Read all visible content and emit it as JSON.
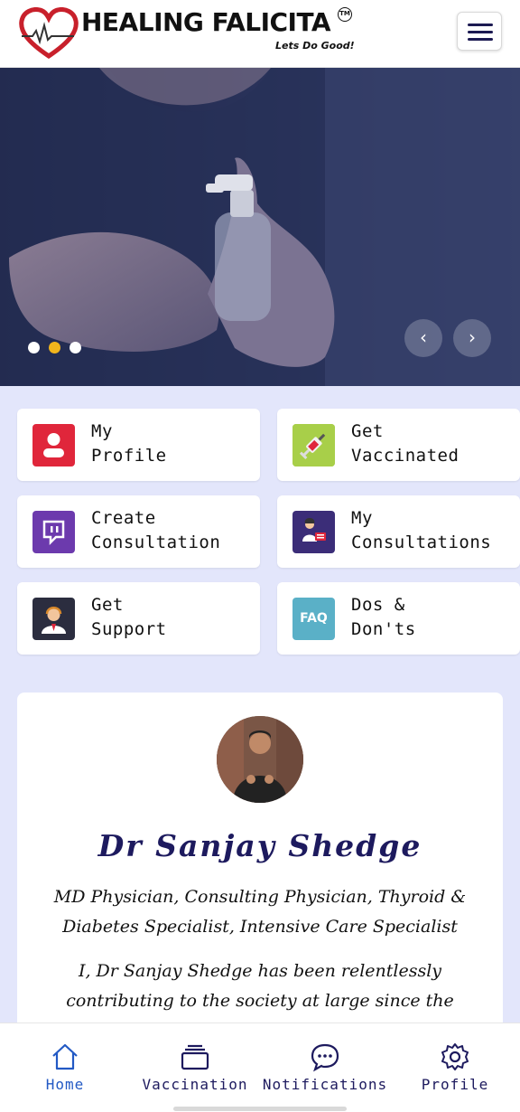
{
  "header": {
    "brand": "HEALING FALICITA",
    "trademark": "TM",
    "tagline": "Lets Do Good!",
    "logo_icon": "heart-pulse-icon",
    "menu_icon": "hamburger-menu-icon"
  },
  "hero": {
    "slide_count": 3,
    "active_slide": 2,
    "prev_icon": "chevron-left-icon",
    "next_icon": "chevron-right-icon",
    "prev_glyph": "‹",
    "next_glyph": "›"
  },
  "tiles": [
    {
      "label": "My\nProfile",
      "icon": "user-profile-icon",
      "color": "#e0263b"
    },
    {
      "label": "Get\nVaccinated",
      "icon": "syringe-icon",
      "color": "#9ec43c"
    },
    {
      "label": "Create\nConsultation",
      "icon": "chat-consultation-icon",
      "color": "#6c3aad"
    },
    {
      "label": "My\nConsultations",
      "icon": "doctor-icon",
      "color": "#3b2d78"
    },
    {
      "label": "Get\nSupport",
      "icon": "support-agent-icon",
      "color": "#2b2d3f"
    },
    {
      "label": "Dos &\nDon'ts",
      "icon": "faq-icon",
      "icon_text": "FAQ",
      "color": "#5ab0c7"
    }
  ],
  "doctor": {
    "name": "Dr Sanjay Shedge",
    "specialization": "MD Physician, Consulting Physician, Thyroid & Diabetes Specialist, Intensive Care Specialist",
    "bio": "I, Dr Sanjay Shedge has been relentlessly contributing to the society at large since the"
  },
  "bottom_nav": [
    {
      "label": "Home",
      "icon": "home-icon",
      "active": true
    },
    {
      "label": "Vaccination",
      "icon": "stack-icon",
      "active": false
    },
    {
      "label": "Notifications",
      "icon": "chat-bubble-icon",
      "active": false
    },
    {
      "label": "Profile",
      "icon": "gear-icon",
      "active": false
    }
  ],
  "colors": {
    "accent": "#1d1a5e",
    "active_nav": "#2259c4",
    "background": "#e3e6fb",
    "dot_active": "#f1b51c"
  }
}
